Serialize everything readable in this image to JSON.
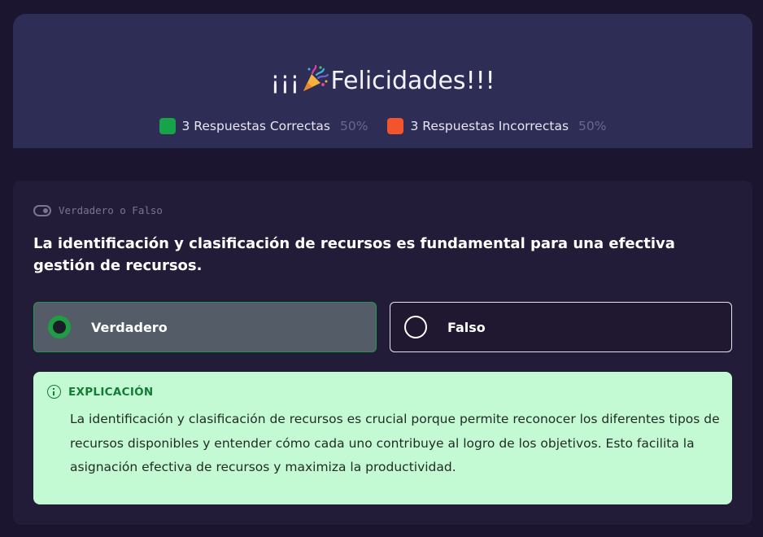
{
  "header": {
    "title_prefix": "¡¡¡",
    "title_suffix": "Felicidades!!!",
    "title_icon": "party-popper-icon",
    "correct": {
      "label": "3 Respuestas Correctas",
      "percent": "50%",
      "color": "#17a34a"
    },
    "incorrect": {
      "label": "3 Respuestas Incorrectas",
      "percent": "50%",
      "color": "#f2542d"
    }
  },
  "question": {
    "type_label": "Verdadero o Falso",
    "type_icon": "toggle-icon",
    "text": "La identificación y clasificación de recursos es fundamental para una efectiva gestión de recursos.",
    "options": [
      {
        "label": "Verdadero",
        "selected": true
      },
      {
        "label": "Falso",
        "selected": false
      }
    ]
  },
  "explanation": {
    "heading": "EXPLICACIÓN",
    "icon": "info-icon",
    "text": "La identificación y clasificación de recursos es crucial porque permite reconocer los diferentes tipos de recursos disponibles y entender cómo cada uno contribuye al logro de los objetivos. Esto facilita la asignación efectiva de recursos y maximiza la productividad."
  }
}
